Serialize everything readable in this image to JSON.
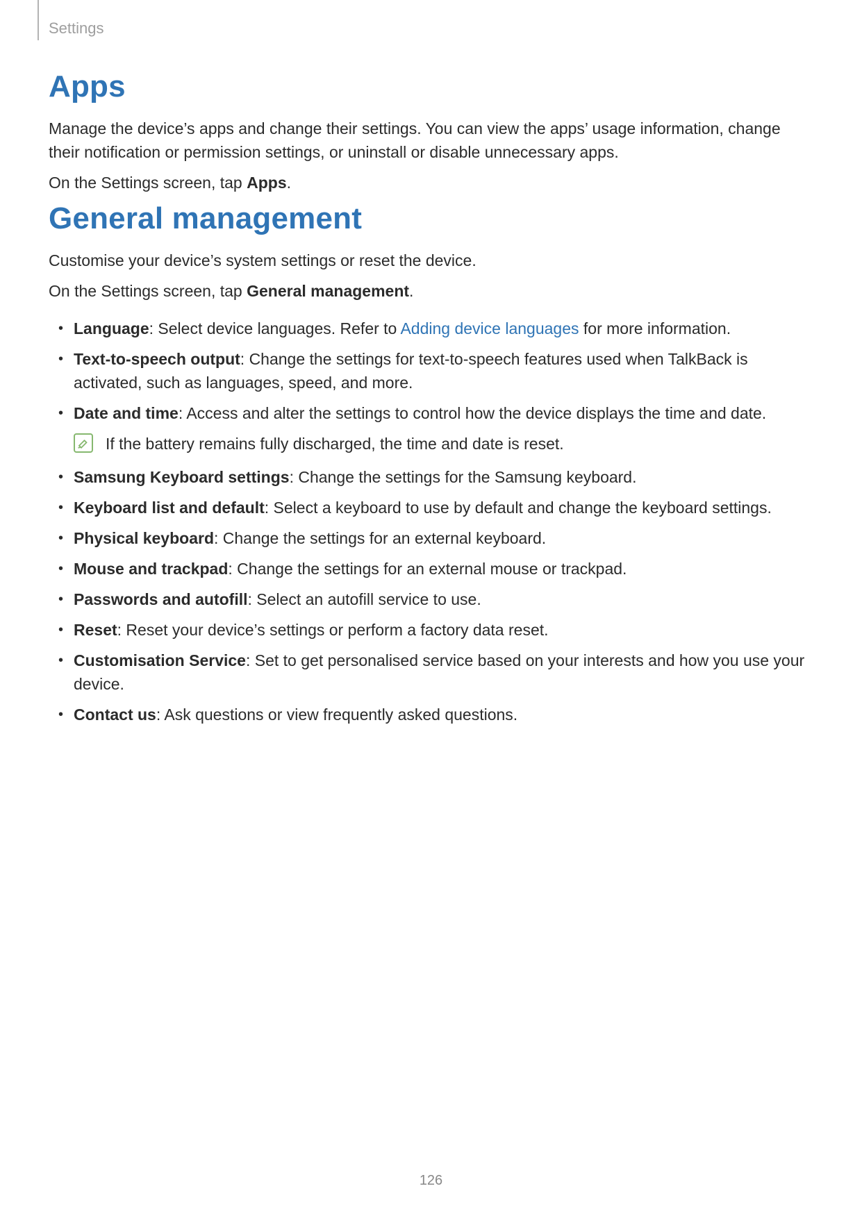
{
  "breadcrumb": "Settings",
  "page_number": "126",
  "apps": {
    "heading": "Apps",
    "p1": "Manage the device’s apps and change their settings. You can view the apps’ usage information, change their notification or permission settings, or uninstall or disable unnecessary apps.",
    "p2_prefix": "On the Settings screen, tap ",
    "p2_bold": "Apps",
    "p2_suffix": "."
  },
  "gm": {
    "heading": "General management",
    "p1": "Customise your device’s system settings or reset the device.",
    "p2_prefix": "On the Settings screen, tap ",
    "p2_bold": "General management",
    "p2_suffix": ".",
    "items": [
      {
        "label": "Language",
        "text_before_link": ": Select device languages. Refer to ",
        "link": "Adding device languages",
        "text_after_link": " for more information."
      },
      {
        "label": "Text-to-speech output",
        "text": ": Change the settings for text-to-speech features used when TalkBack is activated, such as languages, speed, and more."
      },
      {
        "label": "Date and time",
        "text": ": Access and alter the settings to control how the device displays the time and date.",
        "note": "If the battery remains fully discharged, the time and date is reset."
      },
      {
        "label": "Samsung Keyboard settings",
        "text": ": Change the settings for the Samsung keyboard."
      },
      {
        "label": "Keyboard list and default",
        "text": ": Select a keyboard to use by default and change the keyboard settings."
      },
      {
        "label": "Physical keyboard",
        "text": ": Change the settings for an external keyboard."
      },
      {
        "label": "Mouse and trackpad",
        "text": ": Change the settings for an external mouse or trackpad."
      },
      {
        "label": "Passwords and autofill",
        "text": ": Select an autofill service to use."
      },
      {
        "label": "Reset",
        "text": ": Reset your device’s settings or perform a factory data reset."
      },
      {
        "label": "Customisation Service",
        "text": ": Set to get personalised service based on your interests and how you use your device."
      },
      {
        "label": "Contact us",
        "text": ": Ask questions or view frequently asked questions."
      }
    ]
  }
}
